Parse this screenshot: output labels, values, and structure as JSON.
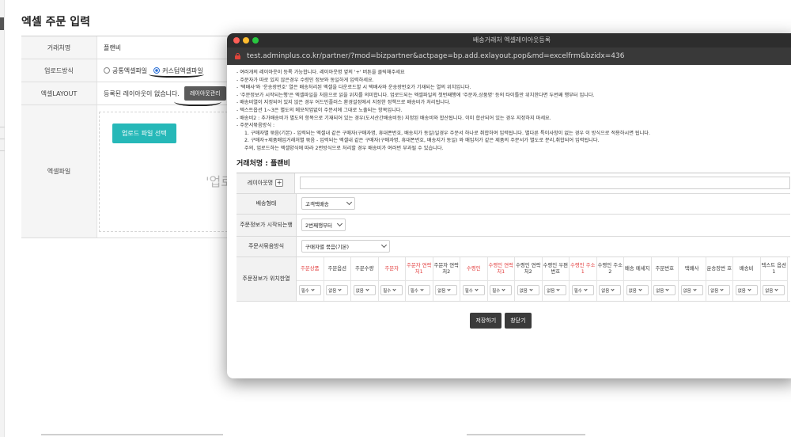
{
  "background_page": {
    "title": "엑셀 주문 입력",
    "rows": {
      "partner": {
        "label": "거래처명",
        "value": "플랜비"
      },
      "upload_type": {
        "label": "업로드방식",
        "options": [
          "공통엑셀파일",
          "커스텀엑셀파일"
        ],
        "selected": "커스텀엑셀파일"
      },
      "layout": {
        "label": "엑셀LAYOUT",
        "value": "등록된 레이아웃이 없습니다.",
        "manage_button": "레이아웃관리"
      },
      "excel_file": {
        "label": "엑셀파일",
        "upload_button": "업로드 파일 선택",
        "hint": "'업로"
      }
    }
  },
  "popup": {
    "window_title": "배송거래처 엑셀레이아웃등록",
    "url": "test.adminplus.co.kr/partner/?mod=bizpartner&actpage=bp.add.exlayout.pop&md=excelfrm&bzidx=436",
    "notes": [
      "- 여러개의 레이아웃이 등록 가능합니다. 레이아웃명 옆의 '+' 버튼을 클릭해주세요",
      "- 주문자가 따로 있지 않은경우 수령인 정보와 동일하게 입력하세요.",
      "- '택배사'와 '운송장번호' 열은 배송처리된 엑셀을 다운로드할 시 택배사와 운송장번호가 기재되는 열의 위치입니다.",
      "- '주문정보가 시작되는행'은 엑셀파일을 처음으로 읽을 위치를 의미합니다. 업로드되는 엑셀파일의 첫번째행에 '주문자,상품명' 등의 타이틀만 위치한다면 두번째 행부터 입니다.",
      "- 배송비열이 지정되어 있지 않은 경우 어드민플러스 환경설정에서 지정한 정책으로 배송비가 처리됩니다.",
      "- 텍스트옵션 1~3은 별도의 메모작업없이 주문서에 그대로 노출되는 항목입니다.",
      "- 배송비2 : 추가배송비가 별도의 항목으로 기재되어 있는 경우(도서산간배송비등) 지정된 배송비와 합산됩니다. 이미 합산되어 있는 경우 지정하지 마세요.",
      "- 주문서묶음방식 :"
    ],
    "sub_notes": [
      "1. 구매자별 묶음(기본) - 입력되는 엑셀내 같은 구매자(구매자명, 휴대폰번호, 배송지가 동일)일경우 주문서 하나로 취합하여 입력됩니다. 별다른 특이사항이 없는 경우 이 방식으로 적용하시면 됩니다.",
      "2. 구매자+제품매입거래처별 묶음 - 입력되는 엑셀내 같은 구매자(구매자명, 휴대폰번호, 배송지가 동일) 와 매입처가 같은 제품의 주문서가 별도로 분리,취합되어 입력됩니다.",
      "주의, 업로드하는 엑셀양식에 따라 2번방식으로 처리할 경우 배송비가 여러번 부과될 수 있습니다."
    ],
    "partner_heading": "거래처명 : 플랜비",
    "form": {
      "layout_name_label": "레이아웃명",
      "plus_label": "+",
      "shipping_type_label": "배송형태",
      "shipping_type_value": "고객택배송",
      "start_row_label": "주문정보가 시작되는행",
      "start_row_value": "2번째행부터",
      "bundle_label": "주문서묶음방식",
      "bundle_value": "구매자별 묶음(기본)",
      "position_label": "주문정보가 위치한열",
      "columns": [
        {
          "name": "주문상품",
          "required": true,
          "value": "필수"
        },
        {
          "name": "주문옵션",
          "required": false,
          "value": "없음"
        },
        {
          "name": "주문수량",
          "required": false,
          "value": "없음"
        },
        {
          "name": "주문자",
          "required": true,
          "value": "필수"
        },
        {
          "name": "주문자 연락처1",
          "required": true,
          "value": "필수"
        },
        {
          "name": "주문자 연락처2",
          "required": false,
          "value": "없음"
        },
        {
          "name": "수령인",
          "required": true,
          "value": "필수"
        },
        {
          "name": "수령인 연락처1",
          "required": true,
          "value": "필수"
        },
        {
          "name": "수령인 연락처2",
          "required": false,
          "value": "없음"
        },
        {
          "name": "수령인 우편번호",
          "required": false,
          "value": "없음"
        },
        {
          "name": "수령인 주소1",
          "required": true,
          "value": "필수"
        },
        {
          "name": "수령인 주소2",
          "required": false,
          "value": "없음"
        },
        {
          "name": "배송 메세지",
          "required": false,
          "value": "없음"
        },
        {
          "name": "주문번호",
          "required": false,
          "value": "없음"
        },
        {
          "name": "택배사",
          "required": false,
          "value": "없음"
        },
        {
          "name": "운송장번 호",
          "required": false,
          "value": "없음"
        },
        {
          "name": "배송비",
          "required": false,
          "value": "없음"
        },
        {
          "name": "텍스트 옵션1",
          "required": false,
          "value": "없음"
        }
      ]
    },
    "buttons": {
      "save": "저장하기",
      "close": "창닫기"
    }
  },
  "colors": {
    "accent_teal": "#26b8b8",
    "required_red": "#e23b3b",
    "titlebar": "#2d2d2d",
    "urlbar": "#393939"
  }
}
